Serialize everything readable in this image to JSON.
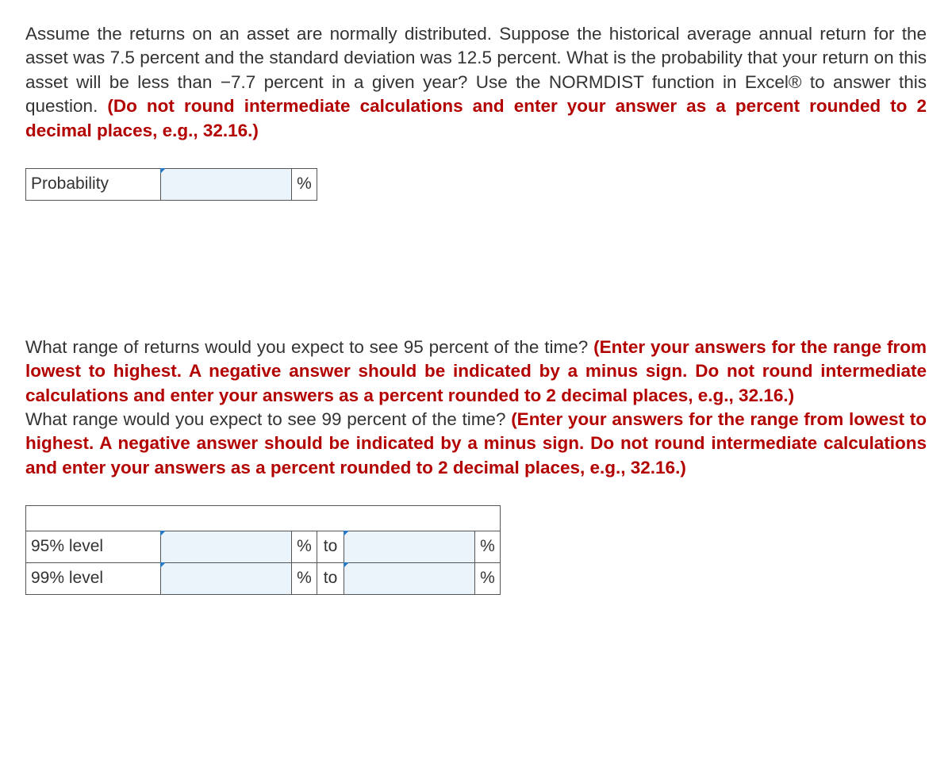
{
  "question1": {
    "p1_part1": "Assume the returns on an asset are normally distributed. Suppose the historical average annual return for the asset was 7.5 percent and the standard deviation was 12.5 percent. What is the probability that your return on this asset will be less than −7.7 percent in a given year? Use the NORMDIST function in Excel® to answer this question. ",
    "p1_red": "(Do not round intermediate calculations and enter your answer as a percent rounded to 2 decimal places, e.g., 32.16.)",
    "table": {
      "label": "Probability",
      "unit": "%"
    }
  },
  "question2": {
    "p2a_part1": "What range of returns would you expect to see 95 percent of the time? ",
    "p2a_red": "(Enter your answers for the range from lowest to highest. A negative answer should be indicated by a minus sign. Do not round intermediate calculations and enter your answers as a percent rounded to 2 decimal places, e.g., 32.16.)",
    "p2b_part1": "What range would you expect to see 99 percent of the time? ",
    "p2b_red": "(Enter your answers for the range from lowest to highest. A negative answer should be indicated by a minus sign. Do not round intermediate calculations and enter your answers as a percent rounded to 2 decimal places, e.g., 32.16.)",
    "rows": [
      {
        "label": "95% level",
        "unit": "%",
        "to": "to"
      },
      {
        "label": "99% level",
        "unit": "%",
        "to": "to"
      }
    ]
  }
}
